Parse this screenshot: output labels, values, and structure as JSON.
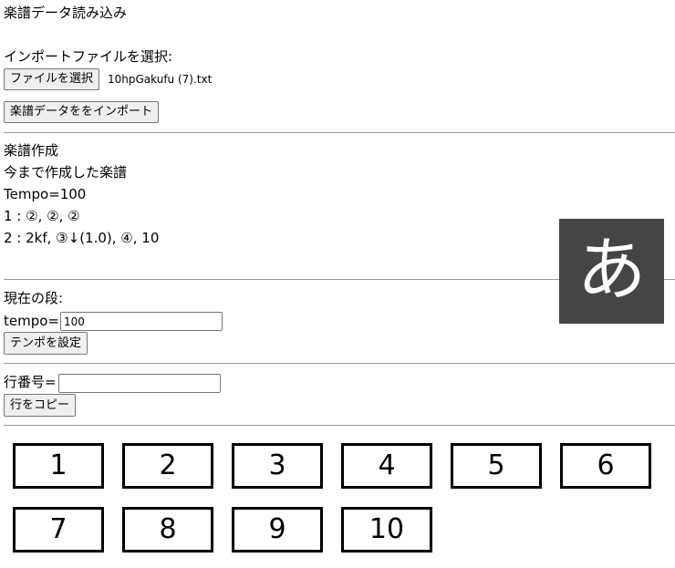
{
  "import_section": {
    "heading": "楽譜データ読み込み",
    "file_label": "インポートファイルを選択:",
    "choose_file_button": "ファイルを選択",
    "file_name": "10hpGakufu (7).txt",
    "import_button": "楽譜データををインポート"
  },
  "score_section": {
    "heading": "楽譜作成",
    "subheading": "今まで作成した楽譜",
    "lines": [
      "Tempo=100",
      "1 : ②, ②, ②",
      "2 : 2kf, ③↓(1.0), ④, 10"
    ]
  },
  "current_row": {
    "label": "現在の段:",
    "tempo_label": "tempo=",
    "tempo_value": "100",
    "set_tempo_button": "テンポを設定"
  },
  "copy_row": {
    "row_label": "行番号=",
    "row_value": "",
    "copy_button": "行をコピー"
  },
  "number_buttons": [
    "1",
    "2",
    "3",
    "4",
    "5",
    "6",
    "7",
    "8",
    "9",
    "10"
  ],
  "ime_indicator": {
    "glyph": "あ",
    "background": "#454545"
  }
}
